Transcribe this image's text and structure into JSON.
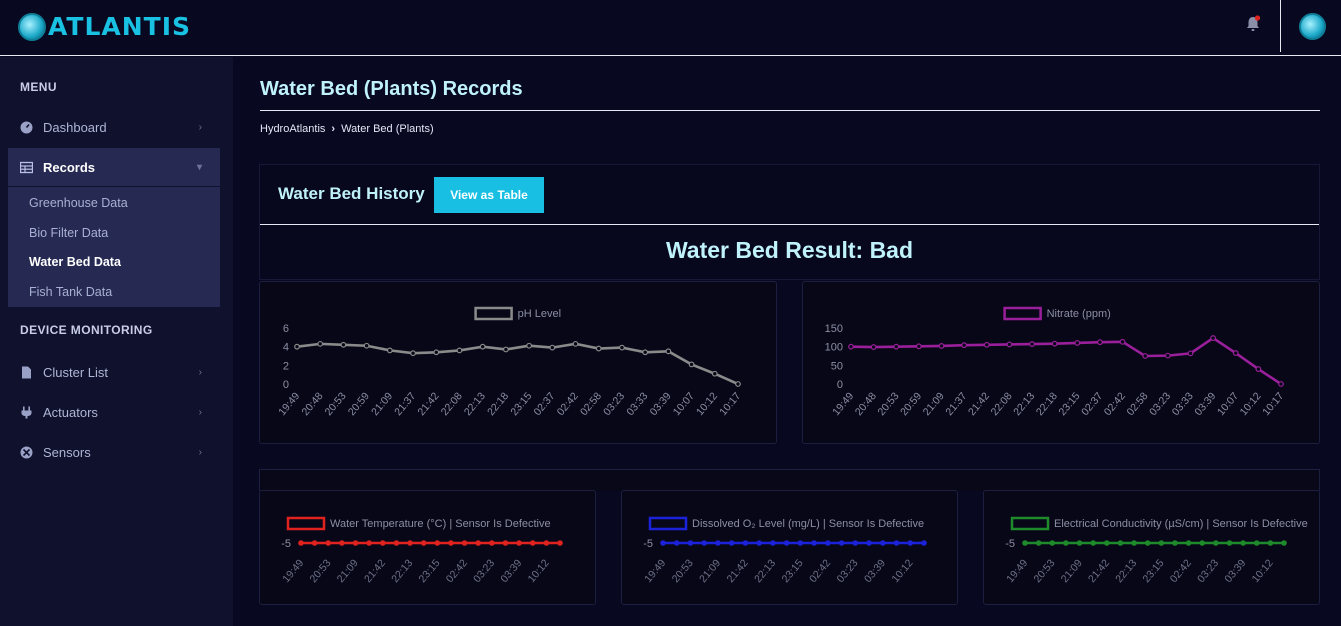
{
  "app": {
    "logo_text": "ATLANTIS"
  },
  "sidebar": {
    "menu_heading": "MENU",
    "device_heading": "DEVICE MONITORING",
    "items": [
      {
        "label": "Dashboard",
        "icon": "gauge-icon"
      },
      {
        "label": "Records",
        "icon": "table-icon"
      },
      {
        "label": "Cluster List",
        "icon": "file-icon"
      },
      {
        "label": "Actuators",
        "icon": "plug-icon"
      },
      {
        "label": "Sensors",
        "icon": "crosshair-icon"
      }
    ],
    "records_sub": [
      {
        "label": "Greenhouse Data"
      },
      {
        "label": "Bio Filter Data"
      },
      {
        "label": "Water Bed Data"
      },
      {
        "label": "Fish Tank Data"
      }
    ]
  },
  "page": {
    "title": "Water Bed (Plants) Records",
    "breadcrumb": [
      "HydroAtlantis",
      "Water Bed (Plants)"
    ],
    "panel_title": "Water Bed History",
    "view_table_button": "View as Table",
    "result": "Water Bed Result: Bad"
  },
  "chart_data": [
    {
      "type": "line",
      "legend": "pH Level",
      "color": "#8a8a8a",
      "x": [
        "19:49",
        "20:48",
        "20:53",
        "20:59",
        "21:09",
        "21:37",
        "21:42",
        "22:08",
        "22:13",
        "22:18",
        "23:15",
        "02:37",
        "02:42",
        "02:58",
        "03:23",
        "03:33",
        "03:39",
        "10:07",
        "10:12",
        "10:17"
      ],
      "values": [
        4.0,
        4.3,
        4.2,
        4.1,
        3.6,
        3.3,
        3.4,
        3.6,
        4.0,
        3.7,
        4.1,
        3.9,
        4.3,
        3.8,
        3.9,
        3.4,
        3.5,
        2.1,
        1.1,
        0
      ],
      "yticks": [
        0,
        2,
        4,
        6
      ],
      "ylim": [
        0,
        6
      ]
    },
    {
      "type": "line",
      "legend": "Nitrate (ppm)",
      "color": "#9a1f9a",
      "x": [
        "19:49",
        "20:48",
        "20:53",
        "20:59",
        "21:09",
        "21:37",
        "21:42",
        "22:08",
        "22:13",
        "22:18",
        "23:15",
        "02:37",
        "02:42",
        "02:58",
        "03:23",
        "03:33",
        "03:39",
        "10:07",
        "10:12",
        "10:17"
      ],
      "values": [
        100,
        99,
        100,
        101,
        102,
        104,
        105,
        106,
        107,
        108,
        110,
        112,
        113,
        75,
        76,
        82,
        123,
        83,
        40,
        0
      ],
      "yticks": [
        0,
        50,
        100,
        150
      ],
      "ylim": [
        0,
        150
      ]
    },
    {
      "type": "line",
      "legend": "Water Temperature (°C) | Sensor Is Defective",
      "color": "#e0231f",
      "x": [
        "19:49",
        "20:53",
        "21:09",
        "21:42",
        "22:13",
        "23:15",
        "02:42",
        "03:23",
        "03:39",
        "10:12"
      ],
      "points": 20,
      "value": -5,
      "yticks": [
        -5
      ]
    },
    {
      "type": "line",
      "legend": "Dissolved O₂ Level (mg/L) | Sensor Is Defective",
      "color": "#1c22d9",
      "x": [
        "19:49",
        "20:53",
        "21:09",
        "21:42",
        "22:13",
        "23:15",
        "02:42",
        "03:23",
        "03:39",
        "10:12"
      ],
      "points": 20,
      "value": -5,
      "yticks": [
        -5
      ]
    },
    {
      "type": "line",
      "legend": "Electrical Conductivity (µS/cm) | Sensor Is Defective",
      "color": "#1f8a2b",
      "x": [
        "19:49",
        "20:53",
        "21:09",
        "21:42",
        "22:13",
        "23:15",
        "02:42",
        "03:23",
        "03:39",
        "10:12"
      ],
      "points": 20,
      "value": -5,
      "yticks": [
        -5
      ]
    }
  ]
}
